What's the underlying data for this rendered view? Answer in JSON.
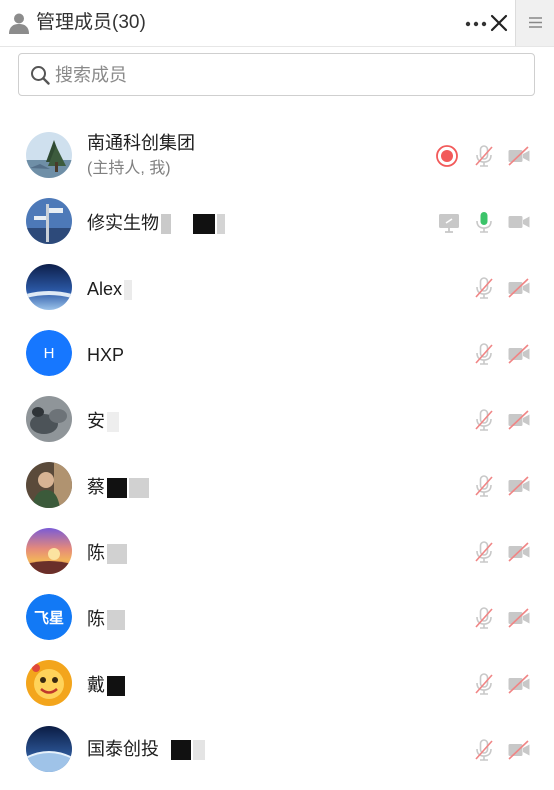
{
  "header": {
    "title": "管理成员(30)",
    "icons": {
      "user": "user-icon",
      "more": "more-icon",
      "close": "close-icon",
      "menu": "menu-icon"
    }
  },
  "search": {
    "placeholder": "搜索成员",
    "value": ""
  },
  "colors": {
    "accent": "#1677ff",
    "record": "#f25a5a",
    "mic_active": "#3cc46a",
    "muted_red": "#f08585",
    "icon_gray": "#c8c8c8"
  },
  "members": [
    {
      "name": "南通科创集团",
      "subtitle": "(主持人, 我)",
      "avatar": "photo-tree",
      "recording": true,
      "screen_share": false,
      "mic": "muted",
      "camera": "off"
    },
    {
      "name": "修实生物",
      "subtitle": "",
      "avatar": "photo-sign",
      "recording": false,
      "screen_share": true,
      "mic": "on",
      "camera": "available"
    },
    {
      "name": "Alex",
      "subtitle": "",
      "avatar": "photo-sky",
      "recording": false,
      "screen_share": false,
      "mic": "muted",
      "camera": "off"
    },
    {
      "name": "HXP",
      "subtitle": "",
      "avatar": "letter",
      "avatar_text": "H",
      "recording": false,
      "screen_share": false,
      "mic": "muted",
      "camera": "off"
    },
    {
      "name": "安",
      "subtitle": "",
      "avatar": "photo-rock",
      "recording": false,
      "screen_share": false,
      "mic": "muted",
      "camera": "off"
    },
    {
      "name": "蔡",
      "subtitle": "",
      "avatar": "photo-person",
      "recording": false,
      "screen_share": false,
      "mic": "muted",
      "camera": "off"
    },
    {
      "name": "陈",
      "subtitle": "",
      "avatar": "photo-sunset",
      "recording": false,
      "screen_share": false,
      "mic": "muted",
      "camera": "off"
    },
    {
      "name": "陈",
      "subtitle": "",
      "avatar": "feixing",
      "avatar_text": "飞星",
      "recording": false,
      "screen_share": false,
      "mic": "muted",
      "camera": "off"
    },
    {
      "name": "戴",
      "subtitle": "",
      "avatar": "photo-cartoon",
      "recording": false,
      "screen_share": false,
      "mic": "muted",
      "camera": "off"
    },
    {
      "name": "国泰创投",
      "subtitle": "",
      "avatar": "photo-earth",
      "recording": false,
      "screen_share": false,
      "mic": "muted",
      "camera": "off"
    }
  ]
}
